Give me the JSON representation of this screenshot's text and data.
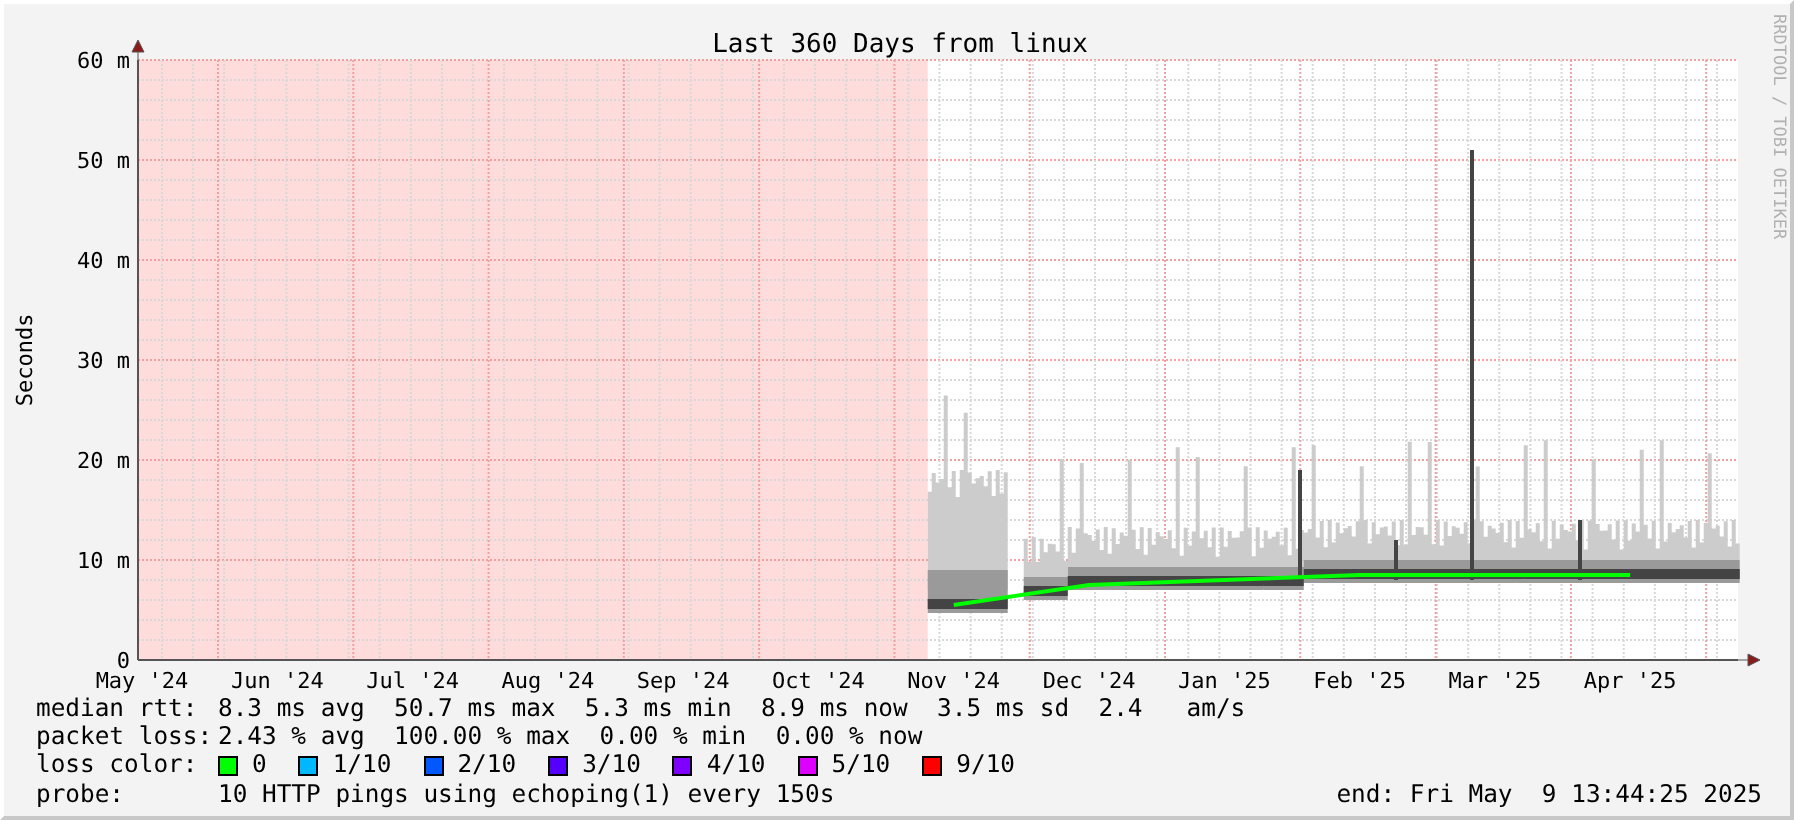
{
  "graph": {
    "credit": "RRDTOOL / TOBI OETIKER",
    "chart_data": {
      "type": "line",
      "title": "Last 360 Days from linux",
      "ylabel": "Seconds",
      "grid": true,
      "categories": [
        "May '24",
        "Jun '24",
        "Jul '24",
        "Aug '24",
        "Sep '24",
        "Oct '24",
        "Nov '24",
        "Dec '24",
        "Jan '25",
        "Feb '25",
        "Mar '25",
        "Apr '25"
      ],
      "series": [
        {
          "color": "#00ff00",
          "values": [
            null,
            null,
            null,
            null,
            null,
            null,
            5.5,
            7.5,
            8,
            8.5,
            8.5,
            8.5
          ]
        }
      ],
      "ylim": [
        0,
        60
      ],
      "yticks": [
        {
          "value": 0,
          "label": "0"
        },
        {
          "value": 10,
          "label": "10 m"
        },
        {
          "value": 20,
          "label": "20 m"
        },
        {
          "value": 30,
          "label": "30 m"
        },
        {
          "value": 40,
          "label": "40 m"
        },
        {
          "value": 50,
          "label": "50 m"
        },
        {
          "value": 60,
          "label": "60 m"
        }
      ]
    }
  },
  "legend": [
    {
      "kind": "stats",
      "label": "median rtt:",
      "text": "8.3 ms avg  50.7 ms max  5.3 ms min  8.9 ms now  3.5 ms sd  2.4   am/s"
    },
    {
      "kind": "stats",
      "label": "packet loss:",
      "text": "2.43 % avg  100.00 % max  0.00 % min  0.00 % now"
    },
    {
      "kind": "colors",
      "label": "loss color:",
      "items": [
        {
          "text": "0",
          "color": "#00ff00"
        },
        {
          "text": "1/10",
          "color": "#00b8ff"
        },
        {
          "text": "2/10",
          "color": "#0059ff"
        },
        {
          "text": "3/10",
          "color": "#5500ff"
        },
        {
          "text": "4/10",
          "color": "#7e00ff"
        },
        {
          "text": "5/10",
          "color": "#dd00ff"
        },
        {
          "text": "9/10",
          "color": "#ff0000"
        }
      ]
    },
    {
      "kind": "probe",
      "label": "probe:",
      "text": "10 HTTP pings using echoping(1) every 150s",
      "end": "end: Fri May  9 13:44:25 2025"
    }
  ]
}
